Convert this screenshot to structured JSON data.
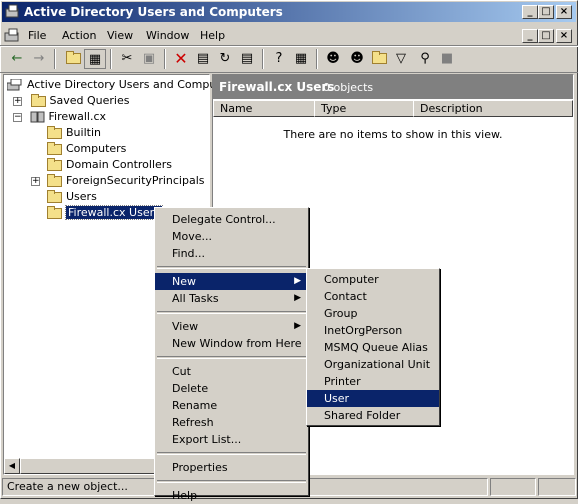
{
  "window": {
    "title": "Active Directory Users and Computers"
  },
  "caption_buttons": {
    "minimize": "_",
    "maximize": "□",
    "close": "×"
  },
  "menubar": {
    "file": "File",
    "action": "Action",
    "view": "View",
    "window": "Window",
    "help": "Help"
  },
  "tree": {
    "root": "Active Directory Users and Computer",
    "saved_queries": "Saved Queries",
    "domain": "Firewall.cx",
    "builtin": "Builtin",
    "computers": "Computers",
    "domain_controllers": "Domain Controllers",
    "foreign": "ForeignSecurityPrincipals",
    "users": "Users",
    "ou_selected": "Firewall.cx Users"
  },
  "details": {
    "title": "Firewall.cx Users",
    "count": "0 objects",
    "columns": [
      "Name",
      "Type",
      "Description"
    ],
    "empty_text": "There are no items to show in this view."
  },
  "context_menu": {
    "delegate": "Delegate Control...",
    "move": "Move...",
    "find": "Find...",
    "new": "New",
    "all_tasks": "All Tasks",
    "view": "View",
    "new_window": "New Window from Here",
    "cut": "Cut",
    "delete": "Delete",
    "rename": "Rename",
    "refresh": "Refresh",
    "export": "Export List...",
    "properties": "Properties",
    "help": "Help"
  },
  "submenu": {
    "items": [
      "Computer",
      "Contact",
      "Group",
      "InetOrgPerson",
      "MSMQ Queue Alias",
      "Organizational Unit",
      "Printer",
      "User",
      "Shared Folder"
    ],
    "selected": "User"
  },
  "status": {
    "text": "Create a new object..."
  },
  "colors": {
    "selection": "#0a246a",
    "titlebar_start": "#0a246a",
    "titlebar_end": "#a6caf0",
    "face": "#d4d0c8"
  }
}
